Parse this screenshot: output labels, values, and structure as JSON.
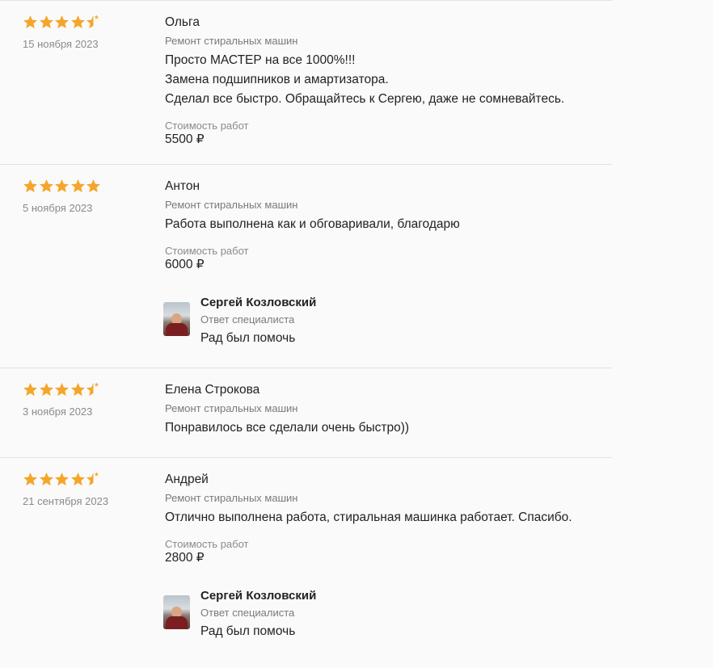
{
  "colors": {
    "star": "#f4a62a",
    "divider": "#e2e2e2"
  },
  "reviews": [
    {
      "rating": 4.5,
      "author": "Ольга",
      "date": "15 ноября 2023",
      "service": "Ремонт стиральных машин",
      "text_lines": [
        "Просто МАСТЕР на все 1000%!!!",
        "Замена подшипников и амартизатора.",
        "Сделал все быстро. Обращайтесь к Сергею, даже не сомневайтесь."
      ],
      "cost_label": "Стоимость работ",
      "cost": "5500 ₽"
    },
    {
      "rating": 5,
      "author": "Антон",
      "date": "5 ноября 2023",
      "service": "Ремонт стиральных машин",
      "text_lines": [
        "Работа выполнена как и обговаривали, благодарю"
      ],
      "cost_label": "Стоимость работ",
      "cost": "6000 ₽",
      "reply": {
        "name": "Сергей Козловский",
        "role": "Ответ специалиста",
        "text": "Рад был помочь"
      }
    },
    {
      "rating": 4.5,
      "author": "Елена Строкова",
      "date": "3 ноября 2023",
      "service": "Ремонт стиральных машин",
      "text_lines": [
        "Понравилось все сделали очень быстро))"
      ]
    },
    {
      "rating": 4.5,
      "author": "Андрей",
      "date": "21 сентября 2023",
      "service": "Ремонт стиральных машин",
      "text_lines": [
        "Отлично выполнена работа, стиральная машинка работает. Спасибо."
      ],
      "cost_label": "Стоимость работ",
      "cost": "2800 ₽",
      "reply": {
        "name": "Сергей Козловский",
        "role": "Ответ специалиста",
        "text": "Рад был помочь"
      }
    }
  ]
}
